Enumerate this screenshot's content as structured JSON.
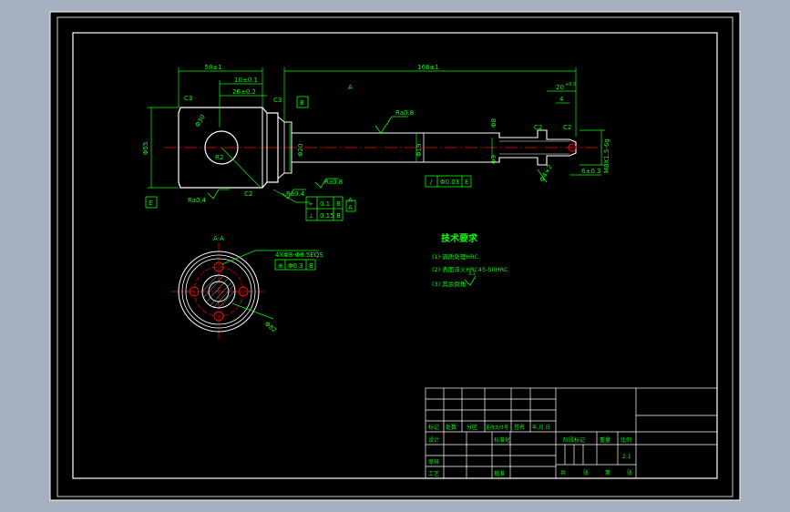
{
  "colors": {
    "background": "#000000",
    "outer_area": "#a5b0c1",
    "frame": "#ffffff",
    "annotation": "#00ff00",
    "centerline": "#ff0000",
    "part_outline": "#ffffff"
  },
  "main_view": {
    "section_mark_top": "A",
    "section_mark_right": "A",
    "dimensions": {
      "overall_length": "166±1",
      "head_length": "58±1",
      "dim_10": "10±0.1",
      "dim_26": "26±0.2",
      "chamfer_left": "C3",
      "chamfer_top": "C3",
      "chamfer_bottom": "C2",
      "chamfer_right1": "C2",
      "chamfer_right2": "C2",
      "dim_20": "20",
      "dim_20_tol": "+0.5",
      "dim_4": "4",
      "thread_right": "M8X1.5-6g",
      "dim_6": "6±0.3",
      "head_diameter": "Φ55",
      "bore_diameter": "Φ30",
      "shaft_diameter": "Φ19",
      "neck_diameter": "Φ20",
      "step_diameter_1": "Φ8",
      "step_diameter_2": "Φ9",
      "groove_label": "Φ4×2",
      "angle_label": "R2"
    },
    "roughness": {
      "top": "Ra0.8",
      "bottom_left": "Ra0.4",
      "bottom_mid": "Ra0.4",
      "bottom_right": "Ra0.8"
    },
    "datums": {
      "top": "B",
      "left": "E",
      "bottom_a": "A",
      "bottom_b": "B"
    },
    "tolerance_frames": {
      "shaft": [
        "/",
        "Φ0.03",
        "E"
      ],
      "bottom_1": [
        "⌖",
        "0.1",
        "B"
      ],
      "bottom_2": [
        "⟂",
        "0.15",
        "B"
      ]
    }
  },
  "section_view": {
    "title": "A-A",
    "hole_callout": "4XΦ8-Φ8.5EQS",
    "tolerance_frame": [
      "⊕",
      "Φ0.3",
      "B"
    ],
    "diameter_label": "Φ82"
  },
  "tech_requirements": {
    "title": "技术要求",
    "items": [
      "(1) 调质处理HRC",
      "(2) 表面淬火HRC45-50HRC",
      "(3) 其余倒角"
    ],
    "roughness_note": "3.2"
  },
  "title_block": {
    "row_labels": [
      "标记",
      "处数",
      "分区",
      "更改文件号",
      "签名",
      "年,月,日"
    ],
    "design": "设计",
    "standardization": "标准化",
    "check": "审核",
    "process": "工艺",
    "approve": "批准",
    "stage_label": "阶段标记",
    "weight": "重量",
    "scale": "比例",
    "scale_value": "2:1",
    "sheet_total": "共",
    "sheet_num": "张",
    "sheet_no": "第",
    "sheet_unit": "张"
  }
}
